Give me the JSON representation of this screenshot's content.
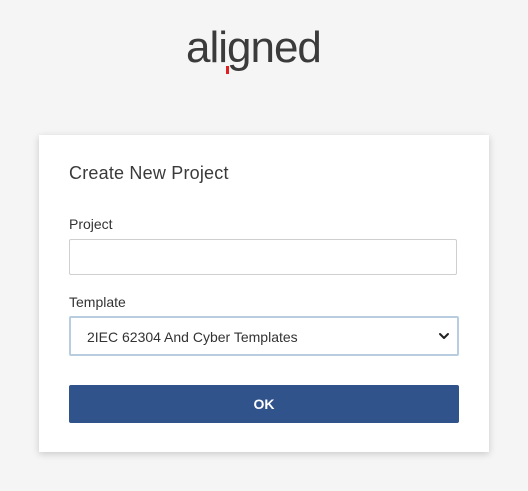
{
  "logo": {
    "text": "aligned",
    "icon": "aligned-logo",
    "accent_color": "#e02020",
    "color": "#3b3b3b"
  },
  "dialog": {
    "title": "Create New Project",
    "project_label": "Project",
    "project_value": "",
    "template_label": "Template",
    "template_selected": "2IEC 62304 And Cyber Templates",
    "ok_label": "OK"
  },
  "colors": {
    "background": "#f5f5f5",
    "button": "#30538c",
    "select_border": "#b8cde0"
  }
}
